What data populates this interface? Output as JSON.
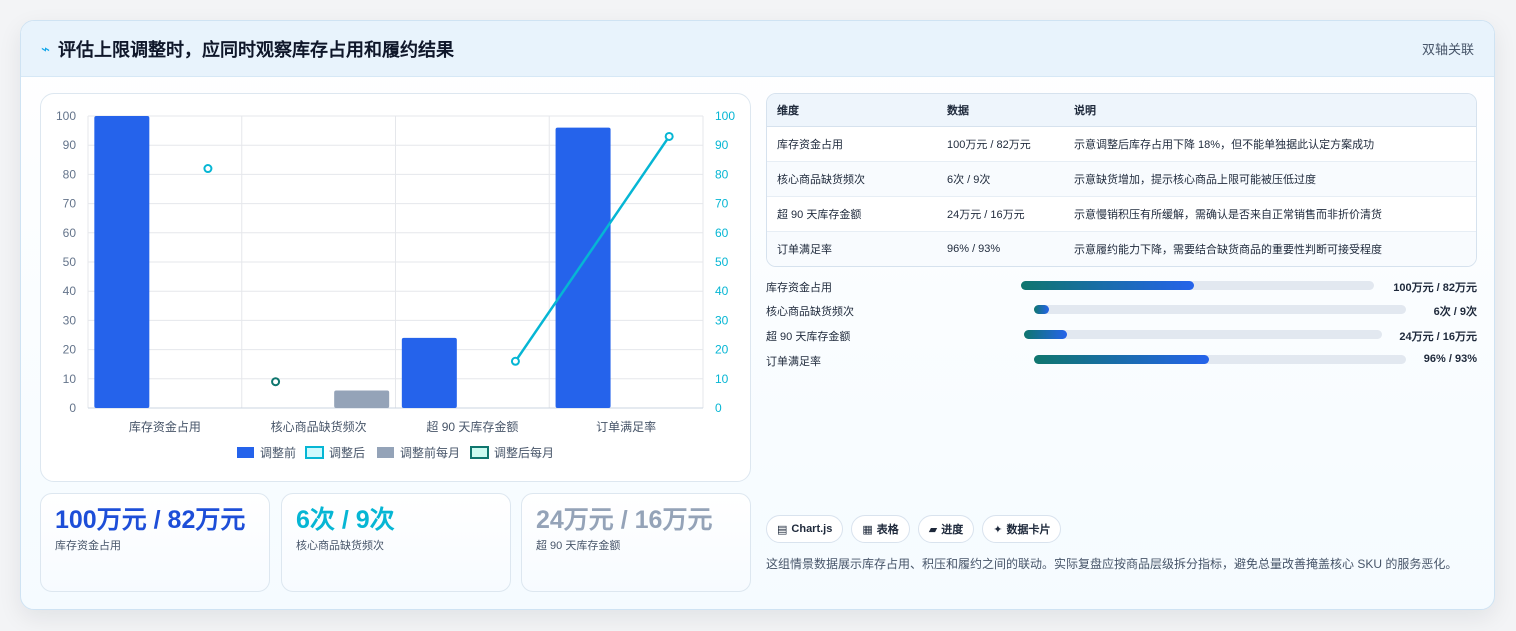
{
  "header": {
    "title": "评估上限调整时，应同时观察库存占用和履约结果",
    "tag": "双轴关联"
  },
  "colors": {
    "before": "#2563eb",
    "after": "#06b6d4",
    "before_monthly": "#94a3b8",
    "after_monthly": "#0f766e"
  },
  "chart_data": {
    "type": "bar",
    "categories": [
      "库存资金占用",
      "核心商品缺货频次",
      "超 90 天库存金额",
      "订单满足率"
    ],
    "series": [
      {
        "name": "调整前",
        "type": "bar",
        "axis": "left",
        "values": [
          100,
          null,
          24,
          96
        ]
      },
      {
        "name": "调整后",
        "type": "line",
        "axis": "right",
        "values": [
          82,
          null,
          16,
          93
        ]
      },
      {
        "name": "调整前每月",
        "type": "bar",
        "axis": "left",
        "values": [
          null,
          6,
          null,
          null
        ]
      },
      {
        "name": "调整后每月",
        "type": "line",
        "axis": "right",
        "values": [
          null,
          9,
          null,
          null
        ]
      }
    ],
    "ylim_left": [
      0,
      100
    ],
    "ylim_right": [
      0,
      100
    ],
    "yticks": [
      "0",
      "10",
      "20",
      "30",
      "40",
      "50",
      "60",
      "70",
      "80",
      "90",
      "100"
    ],
    "grid": true,
    "legend_position": "bottom"
  },
  "table": {
    "headers": [
      "维度",
      "数据",
      "说明"
    ],
    "rows": [
      [
        "库存资金占用",
        "100万元 / 82万元",
        "示意调整后库存占用下降 18%，但不能单独据此认定方案成功"
      ],
      [
        "核心商品缺货频次",
        "6次 / 9次",
        "示意缺货增加，提示核心商品上限可能被压低过度"
      ],
      [
        "超 90 天库存金额",
        "24万元 / 16万元",
        "示意慢销积压有所缓解，需确认是否来自正常销售而非折价清货"
      ],
      [
        "订单满足率",
        "96% / 93%",
        "示意履约能力下降，需要结合缺货商品的重要性判断可接受程度"
      ]
    ]
  },
  "progress": [
    {
      "label": "库存资金占用",
      "value": "100万元 / 82万元",
      "fraction": 0.49
    },
    {
      "label": "核心商品缺货频次",
      "value": "6次 / 9次",
      "fraction": 0.04
    },
    {
      "label": "超 90 天库存金额",
      "value": "24万元 / 16万元",
      "fraction": 0.12
    },
    {
      "label": "订单满足率",
      "value": "96% / 93%",
      "fraction": 0.47
    }
  ],
  "kpis": [
    {
      "value": "100万元 / 82万元",
      "label": "库存资金占用",
      "color": "#1d4ed8"
    },
    {
      "value": "6次 / 9次",
      "label": "核心商品缺货频次",
      "color": "#06b6d4"
    },
    {
      "value": "24万元 / 16万元",
      "label": "超 90 天库存金额",
      "color": "#94a3b8"
    }
  ],
  "chips": [
    {
      "icon": "▤",
      "label": "Chart.js"
    },
    {
      "icon": "▦",
      "label": "表格"
    },
    {
      "icon": "▰",
      "label": "进度"
    },
    {
      "icon": "✦",
      "label": "数据卡片"
    }
  ],
  "note": "这组情景数据展示库存占用、积压和履约之间的联动。实际复盘应按商品层级拆分指标，避免总量改善掩盖核心 SKU 的服务恶化。"
}
